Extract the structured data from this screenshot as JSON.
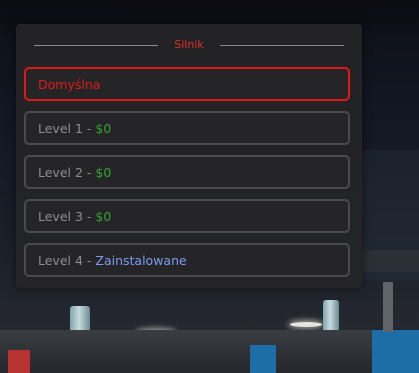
{
  "menu": {
    "title": "Silnik",
    "options": [
      {
        "label": "Domyślna",
        "selected": true
      },
      {
        "label": "Level 1",
        "separator": " - ",
        "status": "$0",
        "status_type": "price"
      },
      {
        "label": "Level 2",
        "separator": " - ",
        "status": "$0",
        "status_type": "price"
      },
      {
        "label": "Level 3",
        "separator": " - ",
        "status": "$0",
        "status_type": "price"
      },
      {
        "label": "Level 4",
        "separator": " - ",
        "status": "Zainstalowane",
        "status_type": "installed"
      }
    ]
  },
  "colors": {
    "accent_red": "#e11818",
    "price_green": "#2fa52f",
    "installed_blue": "#7b9cf0",
    "panel_bg": "#242426",
    "option_border": "#4a4a4c",
    "text_gray": "#8e8e8e"
  }
}
